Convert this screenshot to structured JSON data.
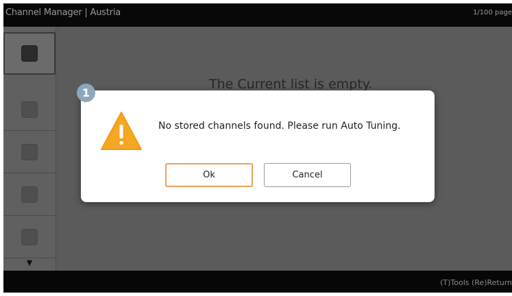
{
  "title_bar": {
    "title": "Channel Manager | Austria",
    "page_count": "1/100 page"
  },
  "main": {
    "empty_message": "The Current list is empty."
  },
  "sidebar": {
    "slots": [
      {
        "state": "selected"
      },
      {
        "state": "normal"
      },
      {
        "state": "normal"
      },
      {
        "state": "normal"
      },
      {
        "state": "normal"
      }
    ],
    "scroll_icon": "down-triangle-icon"
  },
  "dialog": {
    "icon": "warning-triangle-icon",
    "message": "No stored channels found. Please run Auto Tuning.",
    "ok_label": "Ok",
    "cancel_label": "Cancel",
    "callout_number": "1"
  },
  "bottom_bar": {
    "hints": "(T)Tools  (Re)Return"
  },
  "colors": {
    "ok_border": "#e8a05a",
    "warning_fill": "#f5a623",
    "callout": "#8aa7bd"
  }
}
